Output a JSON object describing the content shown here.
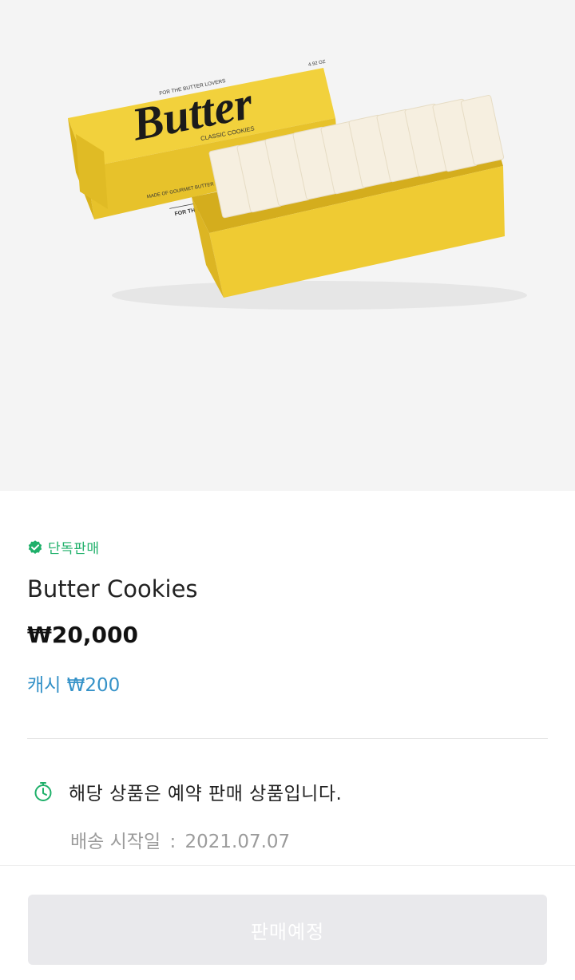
{
  "product": {
    "image_alt": "Butter Classic Cookies box",
    "box_print": {
      "brand": "Butter",
      "line1": "FOR THE BUTTER LOVERS",
      "line2": "CLASSIC COOKIES",
      "line3": "MADE OF GOURMET BUTTER 38.6%",
      "weight": "4.92 OZ",
      "side": "FOR THE BUTT"
    },
    "badge_label": "단독판매",
    "title": "Butter Cookies",
    "price": "₩20,000",
    "cash_label": "캐시",
    "cash_value": "₩200"
  },
  "preorder": {
    "notice": "해당 상품은 예약 판매 상품입니다.",
    "ship_label": "배송 시작일",
    "ship_sep": ":",
    "ship_date": "2021.07.07"
  },
  "cta": {
    "label": "판매예정",
    "enabled": false
  },
  "colors": {
    "accent_green": "#1fb06a",
    "cash_blue": "#3592c8",
    "box_yellow": "#f1cf3a",
    "cta_disabled_bg": "#e9e9ec"
  },
  "icons": {
    "badge": "verified-check-icon",
    "notice": "timer-icon"
  }
}
